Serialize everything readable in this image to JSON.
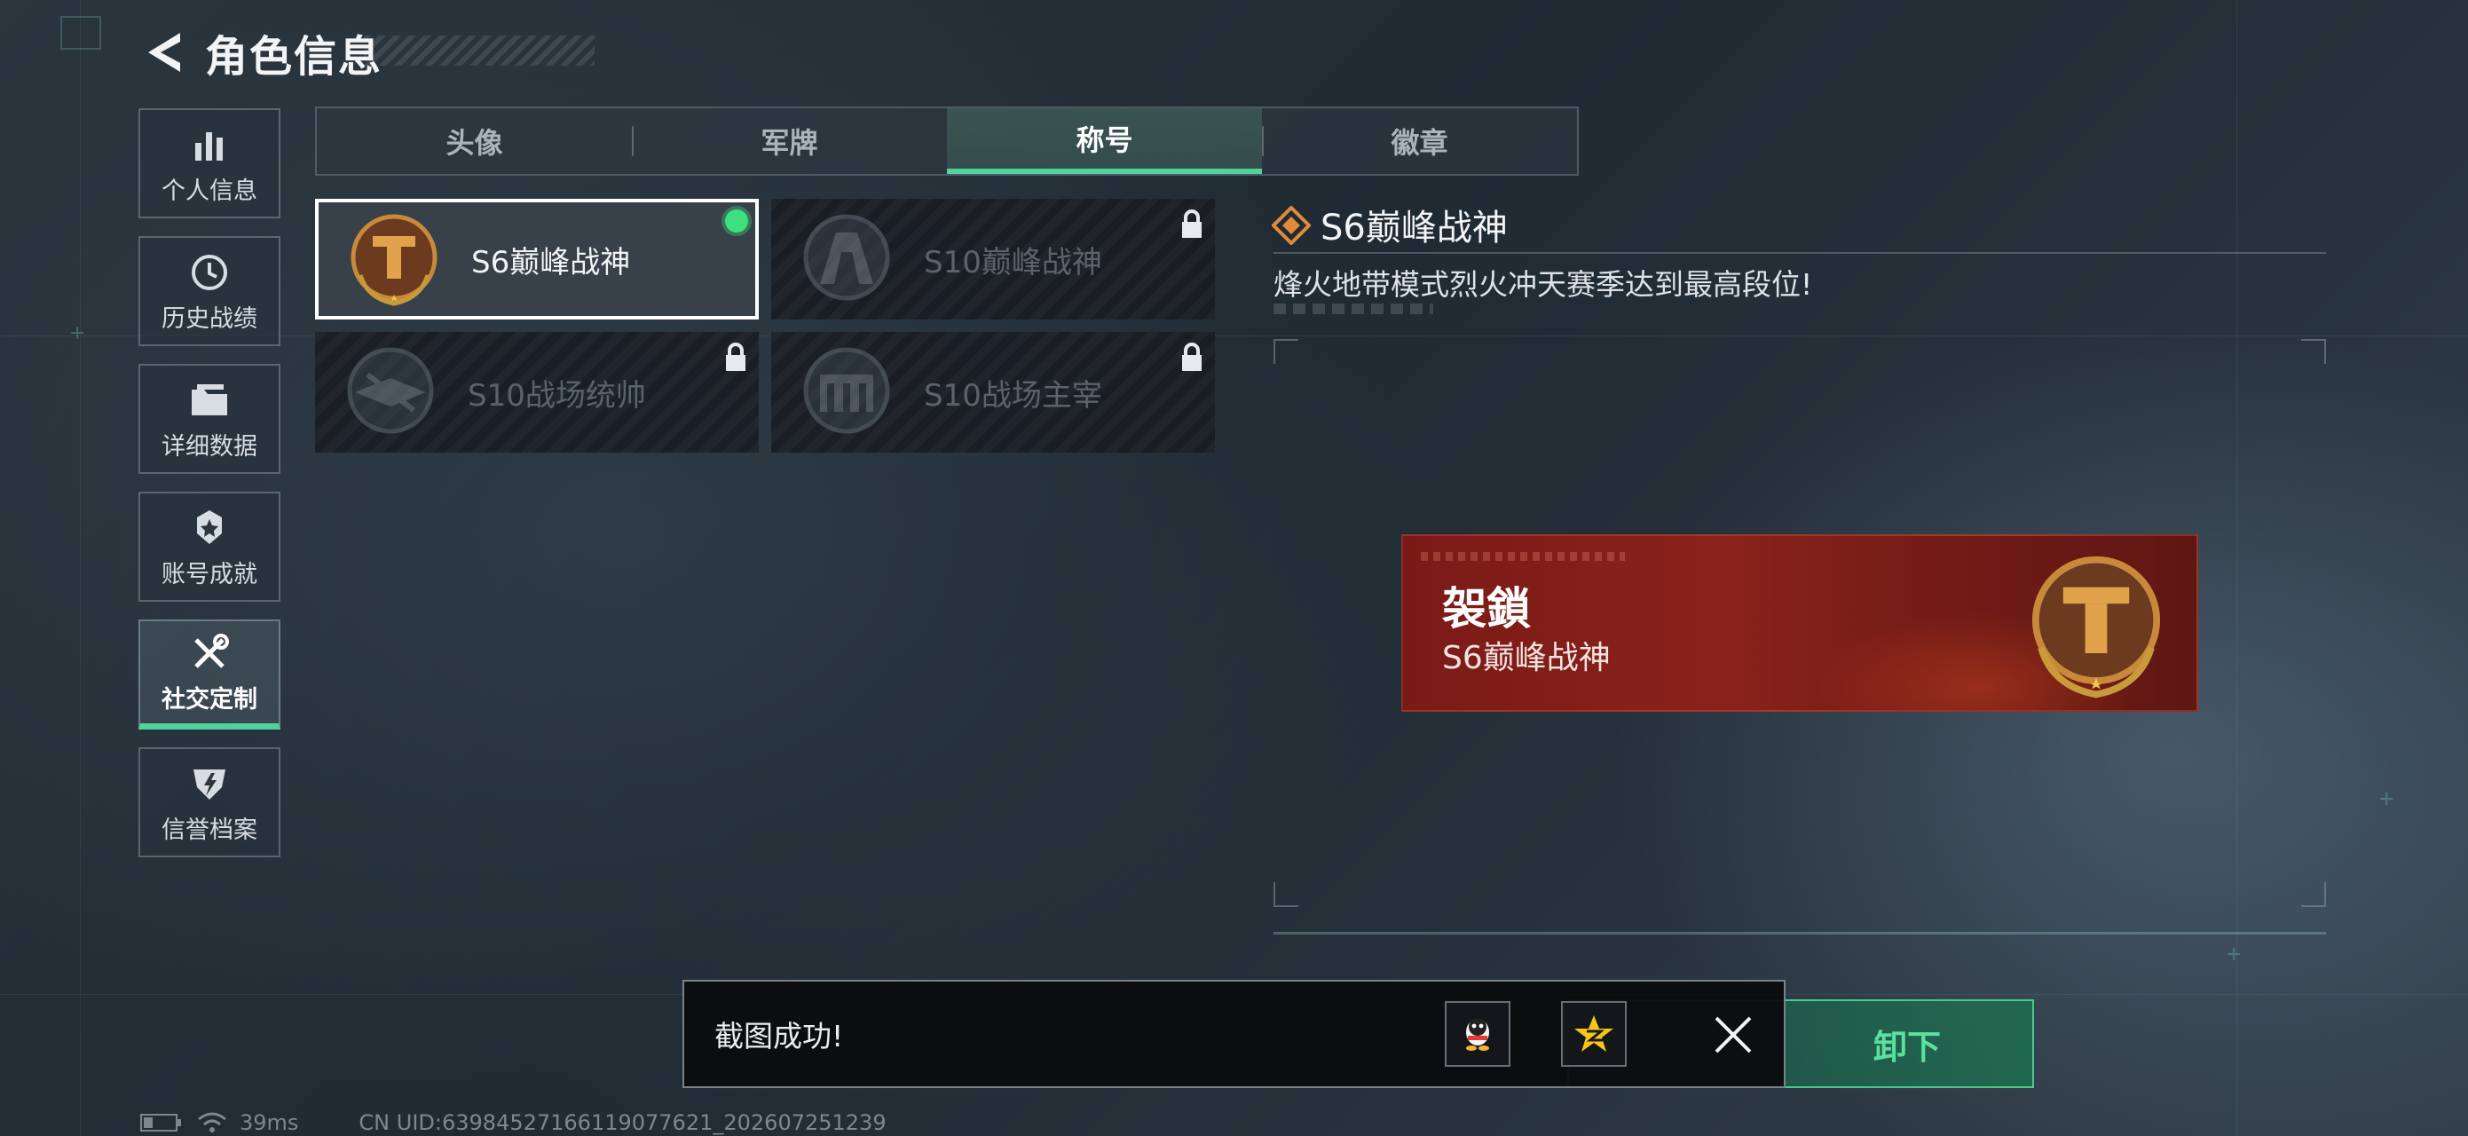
{
  "header": {
    "title": "角色信息",
    "back_icon": "back-arrow-icon"
  },
  "sidebar": {
    "items": [
      {
        "label": "个人信息",
        "icon": "bar-chart-icon"
      },
      {
        "label": "历史战绩",
        "icon": "clock-icon"
      },
      {
        "label": "详细数据",
        "icon": "folder-icon"
      },
      {
        "label": "账号成就",
        "icon": "medal-icon"
      },
      {
        "label": "社交定制",
        "icon": "tools-icon",
        "active": true
      },
      {
        "label": "信誉档案",
        "icon": "shield-icon"
      }
    ]
  },
  "tabs": [
    {
      "label": "头像"
    },
    {
      "label": "军牌"
    },
    {
      "label": "称号",
      "active": true
    },
    {
      "label": "徽章"
    }
  ],
  "titles": [
    {
      "name": "S6巅峰战神",
      "state": "equipped"
    },
    {
      "name": "S10巅峰战神",
      "state": "locked"
    },
    {
      "name": "S10战场统帅",
      "state": "locked"
    },
    {
      "name": "S10战场主宰",
      "state": "locked"
    }
  ],
  "detail": {
    "title": "S6巅峰战神",
    "description": "烽火地带模式烈火冲天赛季达到最高段位!"
  },
  "banner": {
    "player_name": "袈鎖",
    "title": "S6巅峰战神"
  },
  "unequip": {
    "label": "卸下"
  },
  "toast": {
    "message": "截图成功!",
    "share_icons": [
      "qq-icon",
      "qzone-star-icon"
    ]
  },
  "status": {
    "ping": "39ms",
    "uid": "CN UID:63984527166119077621_202607251239"
  },
  "colors": {
    "accent": "#4fd39a",
    "banner": "#7a1a17",
    "equipped": "#3fe07f"
  }
}
